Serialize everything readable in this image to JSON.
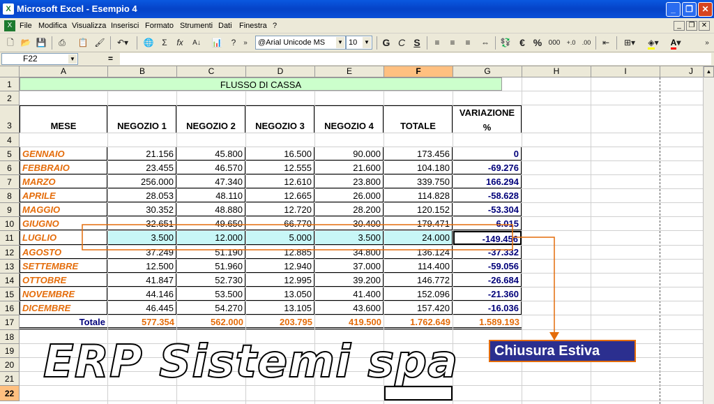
{
  "window": {
    "title": "Microsoft Excel - Esempio 4",
    "app_icon": "excel-icon",
    "buttons": [
      "_",
      "❐",
      "✕"
    ]
  },
  "menu": {
    "items": [
      "File",
      "Modifica",
      "Visualizza",
      "Inserisci",
      "Formato",
      "Strumenti",
      "Dati",
      "Finestra",
      "?"
    ],
    "doc_buttons": [
      "_",
      "❐",
      "✕"
    ]
  },
  "toolbar": {
    "font": "@Arial Unicode MS",
    "size": "10",
    "bold": "G",
    "italic": "C",
    "underline": "S",
    "euro": "€",
    "percent": "%",
    "thousands": "000",
    "sigma": "Σ",
    "fx": "fx",
    "sort": "A↓",
    "help": "?"
  },
  "formula": {
    "cell_ref": "F22",
    "eq": "=",
    "content": ""
  },
  "columns": [
    "A",
    "B",
    "C",
    "D",
    "E",
    "F",
    "G",
    "H",
    "I",
    "J"
  ],
  "rows": [
    "1",
    "2",
    "3",
    "4",
    "5",
    "6",
    "7",
    "8",
    "9",
    "10",
    "11",
    "12",
    "13",
    "14",
    "15",
    "16",
    "17",
    "18",
    "19",
    "20",
    "21",
    "22"
  ],
  "sheet": {
    "title": "FLUSSO DI CASSA",
    "headers": [
      "MESE",
      "NEGOZIO 1",
      "NEGOZIO 2",
      "NEGOZIO 3",
      "NEGOZIO 4",
      "TOTALE",
      "VARIAZIONE",
      "%"
    ],
    "data": [
      [
        "GENNAIO",
        "21.156",
        "45.800",
        "16.500",
        "90.000",
        "173.456",
        "0"
      ],
      [
        "FEBBRAIO",
        "23.455",
        "46.570",
        "12.555",
        "21.600",
        "104.180",
        "-69.276"
      ],
      [
        "MARZO",
        "256.000",
        "47.340",
        "12.610",
        "23.800",
        "339.750",
        "166.294"
      ],
      [
        "APRILE",
        "28.053",
        "48.110",
        "12.665",
        "26.000",
        "114.828",
        "-58.628"
      ],
      [
        "MAGGIO",
        "30.352",
        "48.880",
        "12.720",
        "28.200",
        "120.152",
        "-53.304"
      ],
      [
        "GIUGNO",
        "32.651",
        "49.650",
        "66.770",
        "30.400",
        "179.471",
        "6.015"
      ],
      [
        "LUGLIO",
        "3.500",
        "12.000",
        "5.000",
        "3.500",
        "24.000",
        "-149.456"
      ],
      [
        "AGOSTO",
        "37.249",
        "51.190",
        "12.885",
        "34.800",
        "136.124",
        "-37.332"
      ],
      [
        "SETTEMBRE",
        "12.500",
        "51.960",
        "12.940",
        "37.000",
        "114.400",
        "-59.056"
      ],
      [
        "OTTOBRE",
        "41.847",
        "52.730",
        "12.995",
        "39.200",
        "146.772",
        "-26.684"
      ],
      [
        "NOVEMBRE",
        "44.146",
        "53.500",
        "13.050",
        "41.400",
        "152.096",
        "-21.360"
      ],
      [
        "DICEMBRE",
        "46.445",
        "54.270",
        "13.105",
        "43.600",
        "157.420",
        "-16.036"
      ]
    ],
    "totals": [
      "Totale",
      "577.354",
      "562.000",
      "203.795",
      "419.500",
      "1.762.649",
      "1.589.193"
    ],
    "highlight_color": "#c8f7f7",
    "title_color": "#ccffcc"
  },
  "overlay": {
    "watermark": "ERP Sistemi spa",
    "callout": "Chiusura Estiva",
    "accent": "#e46c0a",
    "callout_bg": "#2b2f8f"
  }
}
